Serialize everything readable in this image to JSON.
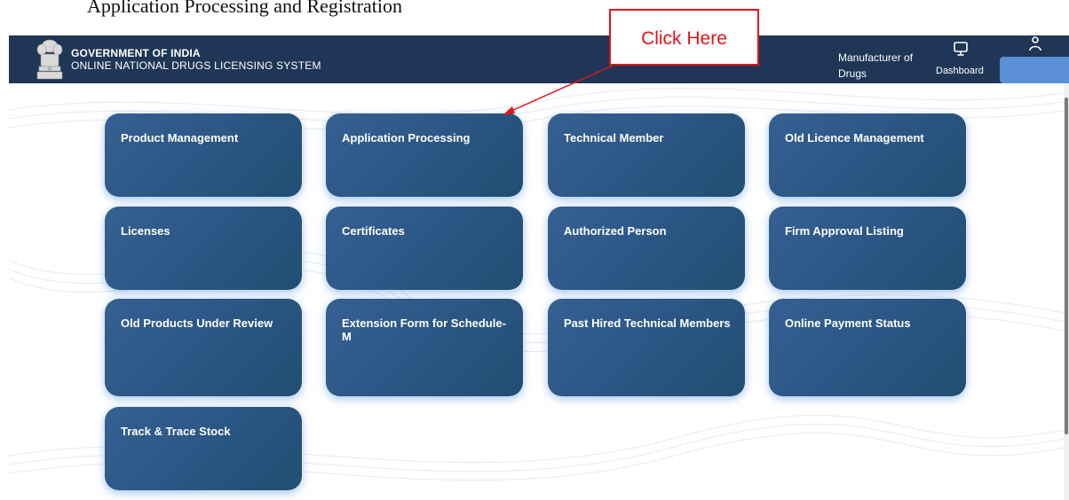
{
  "caption": "Application Processing and Registration",
  "header": {
    "org_line1": "GOVERNMENT OF INDIA",
    "org_line2": "ONLINE NATIONAL DRUGS LICENSING SYSTEM",
    "role_line1": "Manufacturer of",
    "role_line2": "Drugs",
    "dashboard_label": "Dashboard",
    "icons": {
      "emblem": "state-emblem-icon",
      "dashboard": "monitor-icon",
      "user": "user-icon"
    },
    "colors": {
      "bar": "#1f3656",
      "user_pill": "#5b8fd6"
    }
  },
  "tiles": [
    {
      "label": "Product Management"
    },
    {
      "label": "Application Processing"
    },
    {
      "label": "Technical Member"
    },
    {
      "label": "Old Licence Management"
    },
    {
      "label": "Licenses"
    },
    {
      "label": "Certificates"
    },
    {
      "label": "Authorized Person"
    },
    {
      "label": "Firm Approval Listing"
    },
    {
      "label": "Old Products Under Review"
    },
    {
      "label": "Extension Form for Schedule-M"
    },
    {
      "label": "Past Hired Technical Members"
    },
    {
      "label": "Online Payment Status"
    },
    {
      "label": "Track & Trace Stock"
    }
  ],
  "callout": {
    "text": "Click Here",
    "color": "#e0151b"
  },
  "tile_colors": {
    "start": "#356092",
    "end": "#214e72",
    "glow": "#5a96dc"
  }
}
